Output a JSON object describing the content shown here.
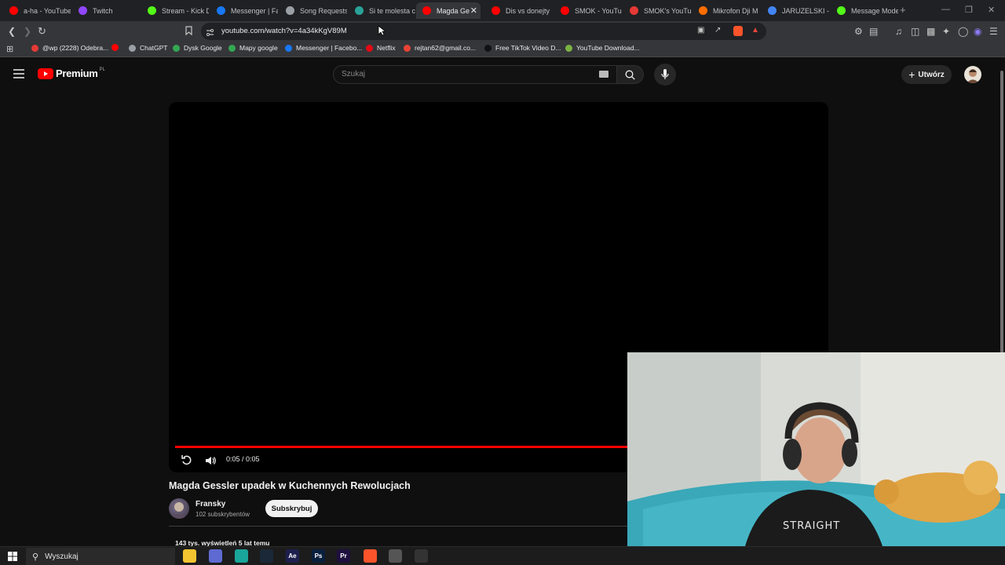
{
  "browser": {
    "tabs": [
      {
        "title": "a-ha - YouTube",
        "icon": "youtube-icon",
        "color": "#ff0000"
      },
      {
        "title": "Twitch",
        "icon": "twitch-icon",
        "color": "#9146ff"
      },
      {
        "title": "Stream - Kick D",
        "icon": "kick-icon",
        "color": "#53fc18"
      },
      {
        "title": "Messenger | Fa",
        "icon": "facebook-icon",
        "color": "#1877f2"
      },
      {
        "title": "Song Requests",
        "icon": "song-requests-icon",
        "color": "#9aa0a6"
      },
      {
        "title": "Si te molesta c",
        "icon": "tab-icon",
        "color": "#2aa198"
      },
      {
        "title": "Magda Ge",
        "icon": "youtube-icon",
        "color": "#ff0000",
        "active": true
      },
      {
        "title": "Dis vs donejty",
        "icon": "youtube-icon",
        "color": "#ff0000"
      },
      {
        "title": "SMOK - YouTu",
        "icon": "youtube-icon",
        "color": "#ff0000"
      },
      {
        "title": "SMOK's YouTu",
        "icon": "chart-icon",
        "color": "#e53935"
      },
      {
        "title": "Mikrofon Dji M",
        "icon": "shop-icon",
        "color": "#ff6d00"
      },
      {
        "title": "JARUZELSKI - S",
        "icon": "google-icon",
        "color": "#4285f4"
      },
      {
        "title": "Message Mode",
        "icon": "kick-icon",
        "color": "#53fc18"
      }
    ],
    "url": "youtube.com/watch?v=4a34kKgV89M",
    "bookmarks": [
      {
        "label": "@wp (2228) Odebra...",
        "color": "#e53935"
      },
      {
        "label": "",
        "color": "#ff0000"
      },
      {
        "label": "ChatGPT",
        "color": "#9aa0a6"
      },
      {
        "label": "Dysk Google",
        "color": "#34a853"
      },
      {
        "label": "Mapy google",
        "color": "#34a853"
      },
      {
        "label": "Messenger | Facebo...",
        "color": "#1877f2"
      },
      {
        "label": "Netflix",
        "color": "#e50914"
      },
      {
        "label": "rejtan62@gmail.co...",
        "color": "#ea4335"
      },
      {
        "label": "Free TikTok Video D...",
        "color": "#111111"
      },
      {
        "label": "YouTube Download...",
        "color": "#7cb342"
      }
    ]
  },
  "youtube": {
    "logo_text": "Premium",
    "logo_region": "PL",
    "search_placeholder": "Szukaj",
    "create_label": "Utwórz",
    "player": {
      "time": "0:05 / 0:05",
      "progress": 1.0
    },
    "video": {
      "title": "Magda Gessler upadek w Kuchennych Rewolucjach",
      "channel": "Fransky",
      "subscribers": "102 subskrybentów",
      "subscribe_label": "Subskrybuj",
      "views_line": "143 tys. wyświetleń  5 lat temu"
    }
  },
  "taskbar": {
    "search_label": "Wyszukaj",
    "apps": [
      {
        "name": "file-explorer-icon",
        "label": "",
        "color": "#f4c430"
      },
      {
        "name": "browser-icon",
        "label": "",
        "color": "#5e6ad2"
      },
      {
        "name": "app-icon",
        "label": "",
        "color": "#1aa59a"
      },
      {
        "name": "steam-icon",
        "label": "",
        "color": "#1b2838"
      },
      {
        "name": "after-effects-icon",
        "label": "Ae",
        "color": "#1f1f4f"
      },
      {
        "name": "photoshop-icon",
        "label": "Ps",
        "color": "#0a1f3d"
      },
      {
        "name": "premiere-icon",
        "label": "Pr",
        "color": "#1f0f3f"
      },
      {
        "name": "brave-icon",
        "label": "",
        "color": "#fb542b"
      },
      {
        "name": "tool-icon",
        "label": "",
        "color": "#555555"
      },
      {
        "name": "obs-icon",
        "label": "",
        "color": "#333333"
      }
    ]
  }
}
